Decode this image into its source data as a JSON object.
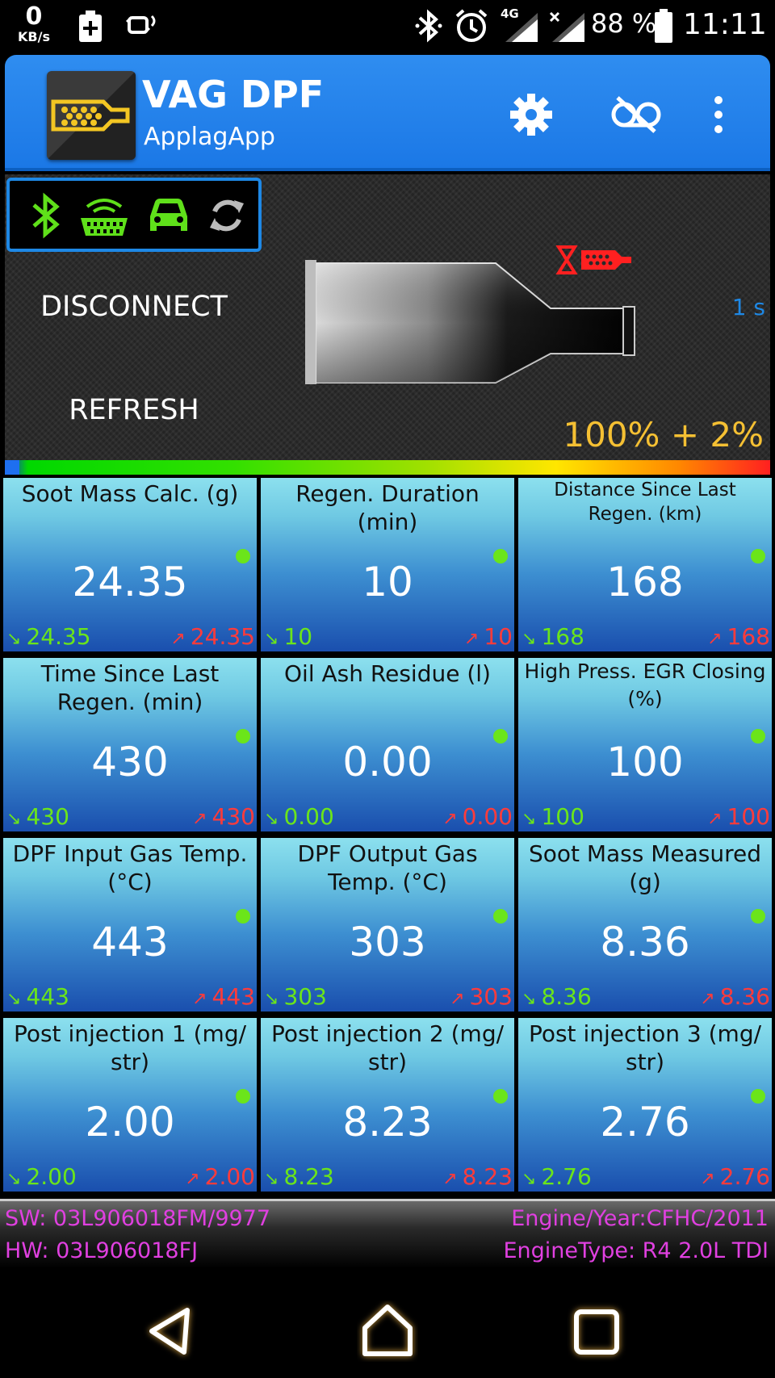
{
  "status_bar": {
    "net_speed": "0",
    "net_unit": "KB/s",
    "network": "4G",
    "battery": "88 %",
    "time": "11:11"
  },
  "app_bar": {
    "title": "VAG DPF",
    "subtitle": "ApplagApp"
  },
  "hero": {
    "disconnect_label": "DISCONNECT",
    "refresh_label": "REFRESH",
    "interval": "1 s",
    "percent": "100% + 2%"
  },
  "tiles": [
    {
      "title": "Soot Mass Calc. (g)",
      "value": "24.35",
      "min": "24.35",
      "max": "24.35"
    },
    {
      "title": "Regen. Duration (min)",
      "value": "10",
      "min": "10",
      "max": "10"
    },
    {
      "title": "Distance Since Last Regen. (km)",
      "value": "168",
      "min": "168",
      "max": "168"
    },
    {
      "title": "Time Since Last Regen. (min)",
      "value": "430",
      "min": "430",
      "max": "430"
    },
    {
      "title": "Oil Ash Residue (l)",
      "value": "0.00",
      "min": "0.00",
      "max": "0.00"
    },
    {
      "title": "High Press. EGR Closing (%)",
      "value": "100",
      "min": "100",
      "max": "100"
    },
    {
      "title": "DPF Input Gas Temp. (°C)",
      "value": "443",
      "min": "443",
      "max": "443"
    },
    {
      "title": "DPF Output Gas Temp. (°C)",
      "value": "303",
      "min": "303",
      "max": "303"
    },
    {
      "title": "Soot Mass Measured (g)",
      "value": "8.36",
      "min": "8.36",
      "max": "8.36"
    },
    {
      "title": "Post injection 1 (mg/ str)",
      "value": "2.00",
      "min": "2.00",
      "max": "2.00"
    },
    {
      "title": "Post injection 2 (mg/ str)",
      "value": "8.23",
      "min": "8.23",
      "max": "8.23"
    },
    {
      "title": "Post injection 3 (mg/ str)",
      "value": "2.76",
      "min": "2.76",
      "max": "2.76"
    }
  ],
  "info": {
    "sw": "SW: 03L906018FM/9977",
    "hw": "HW: 03L906018FJ",
    "engine_year": "Engine/Year:CFHC/2011",
    "engine_type": "EngineType: R4 2.0L TDI"
  },
  "colors": {
    "accent": "#1e88e5",
    "ok": "#6be51a",
    "max": "#ff3b3b",
    "info": "#e040e0",
    "percent": "#f5c033"
  },
  "icons": {
    "status": [
      "plus-icon",
      "bluetooth-icon",
      "alarm-icon",
      "signal-icon",
      "battery-icon"
    ],
    "connection": [
      "bluetooth-icon",
      "obd-adapter-icon",
      "car-icon",
      "sync-icon"
    ],
    "app_bar": [
      "settings-icon",
      "record-off-icon",
      "more-icon"
    ],
    "nav": [
      "back-icon",
      "home-icon",
      "recents-icon"
    ]
  }
}
